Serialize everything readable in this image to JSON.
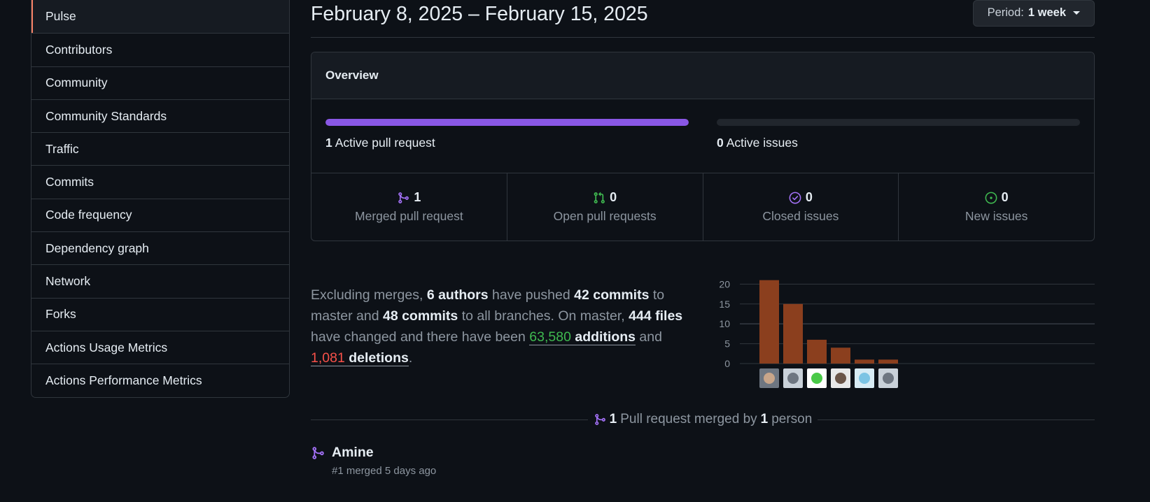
{
  "sidebar": {
    "items": [
      {
        "label": "Pulse"
      },
      {
        "label": "Contributors"
      },
      {
        "label": "Community"
      },
      {
        "label": "Community Standards"
      },
      {
        "label": "Traffic"
      },
      {
        "label": "Commits"
      },
      {
        "label": "Code frequency"
      },
      {
        "label": "Dependency graph"
      },
      {
        "label": "Network"
      },
      {
        "label": "Forks"
      },
      {
        "label": "Actions Usage Metrics"
      },
      {
        "label": "Actions Performance Metrics"
      }
    ]
  },
  "header": {
    "date_range": "February 8, 2025 – February 15, 2025",
    "period_label": "Period:",
    "period_value": "1 week"
  },
  "overview": {
    "title": "Overview",
    "pull_requests": {
      "count": "1",
      "label": "Active pull request",
      "fill_fraction": 1.0
    },
    "issues": {
      "count": "0",
      "label": "Active issues",
      "fill_fraction": 0.0
    },
    "stats": [
      {
        "value": "1",
        "label": "Merged pull request",
        "icon": "git-merge-icon",
        "color": "#a371f7"
      },
      {
        "value": "0",
        "label": "Open pull requests",
        "icon": "git-pull-request-icon",
        "color": "#3fb950"
      },
      {
        "value": "0",
        "label": "Closed issues",
        "icon": "issue-closed-icon",
        "color": "#a371f7"
      },
      {
        "value": "0",
        "label": "New issues",
        "icon": "issue-opened-icon",
        "color": "#3fb950"
      }
    ]
  },
  "summary": {
    "t1": "Excluding merges, ",
    "authors": "6 authors",
    "t2": " have pushed ",
    "commits_master": "42 commits",
    "t3": " to master and ",
    "commits_all": "48 commits",
    "t4": " to all branches. On master, ",
    "files": "444 files",
    "t5": " have changed and there have been ",
    "additions_num": "63,580",
    "additions_word": "additions",
    "t6": " and ",
    "deletions_num": "1,081",
    "deletions_word": "deletions",
    "t7": "."
  },
  "chart_data": {
    "type": "bar",
    "categories": [
      "author-1",
      "author-2",
      "author-3",
      "author-4",
      "author-5",
      "author-6"
    ],
    "values": [
      21,
      15,
      6,
      4,
      1,
      1
    ],
    "ylim": [
      0,
      22
    ],
    "yticks": [
      "0",
      "5",
      "10",
      "15",
      "20"
    ],
    "bar_color": "#8b3f1e",
    "grid": true
  },
  "merged": {
    "count": "1",
    "t1": "Pull request merged by",
    "people": "1",
    "t2": "person"
  },
  "pr": {
    "title": "Amine",
    "meta": "#1 merged 5 days ago"
  }
}
